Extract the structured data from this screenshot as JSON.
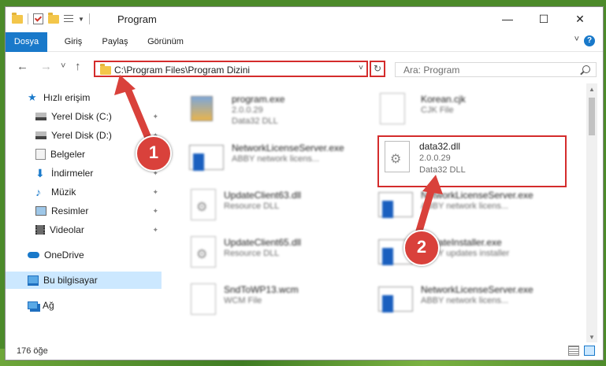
{
  "window": {
    "title": "Program",
    "controls": {
      "minimize": "—",
      "maximize": "☐",
      "close": "✕"
    }
  },
  "ribbon": {
    "tabs": [
      "Dosya",
      "Giriş",
      "Paylaş",
      "Görünüm"
    ],
    "help": "?"
  },
  "navbar": {
    "back_icon": "←",
    "forward_icon": "→",
    "recent_icon": "˅",
    "up_icon": "↑",
    "address": "C:\\Program Files\\Program Dizini",
    "address_dropdown": "˅",
    "refresh_icon": "↻",
    "search_placeholder": "Ara: Program"
  },
  "sidebar": {
    "items": [
      {
        "label": "Hızlı erişim",
        "icon": "star-icon"
      },
      {
        "label": "Yerel Disk (C:)",
        "icon": "drive-icon",
        "pinned": true
      },
      {
        "label": "Yerel Disk (D:)",
        "icon": "drive-icon",
        "pinned": true
      },
      {
        "label": "Belgeler",
        "icon": "documents-icon",
        "pinned": true
      },
      {
        "label": "İndirmeler",
        "icon": "download-icon",
        "pinned": true
      },
      {
        "label": "Müzik",
        "icon": "music-icon",
        "pinned": true
      },
      {
        "label": "Resimler",
        "icon": "pictures-icon",
        "pinned": true
      },
      {
        "label": "Videolar",
        "icon": "video-icon",
        "pinned": true
      },
      {
        "label": "OneDrive",
        "icon": "cloud-icon"
      },
      {
        "label": "Bu bilgisayar",
        "icon": "computer-icon",
        "selected": true
      },
      {
        "label": "Ağ",
        "icon": "network-icon"
      }
    ],
    "pin_glyph": "📌"
  },
  "files": [
    {
      "name": "program.exe",
      "line1": "2.0.0.29",
      "line2": "Data32 DLL",
      "icon": "installer-icon"
    },
    {
      "name": "Korean.cjk",
      "line1": "CJK File",
      "line2": "",
      "icon": "file-icon"
    },
    {
      "name": "NetworkLicenseServer.exe",
      "line1": "ABBY network licens...",
      "line2": "",
      "icon": "app-icon"
    },
    {
      "name": "data32.dll",
      "line1": "2.0.0.29",
      "line2": "Data32 DLL",
      "icon": "dll-icon"
    },
    {
      "name": "UpdateClient63.dll",
      "line1": "Resource DLL",
      "line2": "",
      "icon": "dll-icon"
    },
    {
      "name": "NetworkLicenseServer.exe",
      "line1": "ABBY network licens...",
      "line2": "",
      "icon": "app-icon"
    },
    {
      "name": "UpdateClient65.dll",
      "line1": "Resource DLL",
      "line2": "",
      "icon": "dll-icon"
    },
    {
      "name": "UpdateInstaller.exe",
      "line1": "ABBY updates installer",
      "line2": "",
      "icon": "app-icon"
    },
    {
      "name": "SndToWP13.wcm",
      "line1": "WCM File",
      "line2": "",
      "icon": "file-icon"
    },
    {
      "name": "NetworkLicenseServer.exe",
      "line1": "ABBY network licens...",
      "line2": "",
      "icon": "app-icon"
    }
  ],
  "status": {
    "count": "176 öğe"
  },
  "annotations": {
    "step1": "1",
    "step2": "2"
  }
}
